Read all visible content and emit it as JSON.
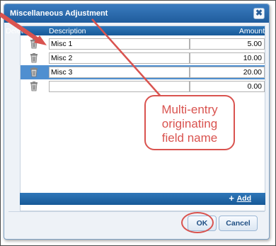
{
  "dialog": {
    "title": "Miscellaneous Adjustment",
    "close_glyph": "✖"
  },
  "grid": {
    "headers": {
      "delete": "Delete",
      "description": "Description",
      "amount": "Amount"
    },
    "rows": [
      {
        "description": "Misc 1",
        "amount": "5.00",
        "selected": false
      },
      {
        "description": "Misc 2",
        "amount": "10.00",
        "selected": false
      },
      {
        "description": "Misc 3",
        "amount": "20.00",
        "selected": true
      },
      {
        "description": "",
        "amount": "0.00",
        "selected": false
      }
    ]
  },
  "footer": {
    "add_plus": "+",
    "add_label": "Add"
  },
  "buttons": {
    "ok": "OK",
    "cancel": "Cancel"
  },
  "annotation": {
    "callout_lines": [
      "Multi-entry",
      "originating",
      "field name"
    ],
    "color": "#d9534f"
  },
  "colors": {
    "title_blue": "#1f5c9c",
    "selected_row": "#4f8fd0"
  }
}
